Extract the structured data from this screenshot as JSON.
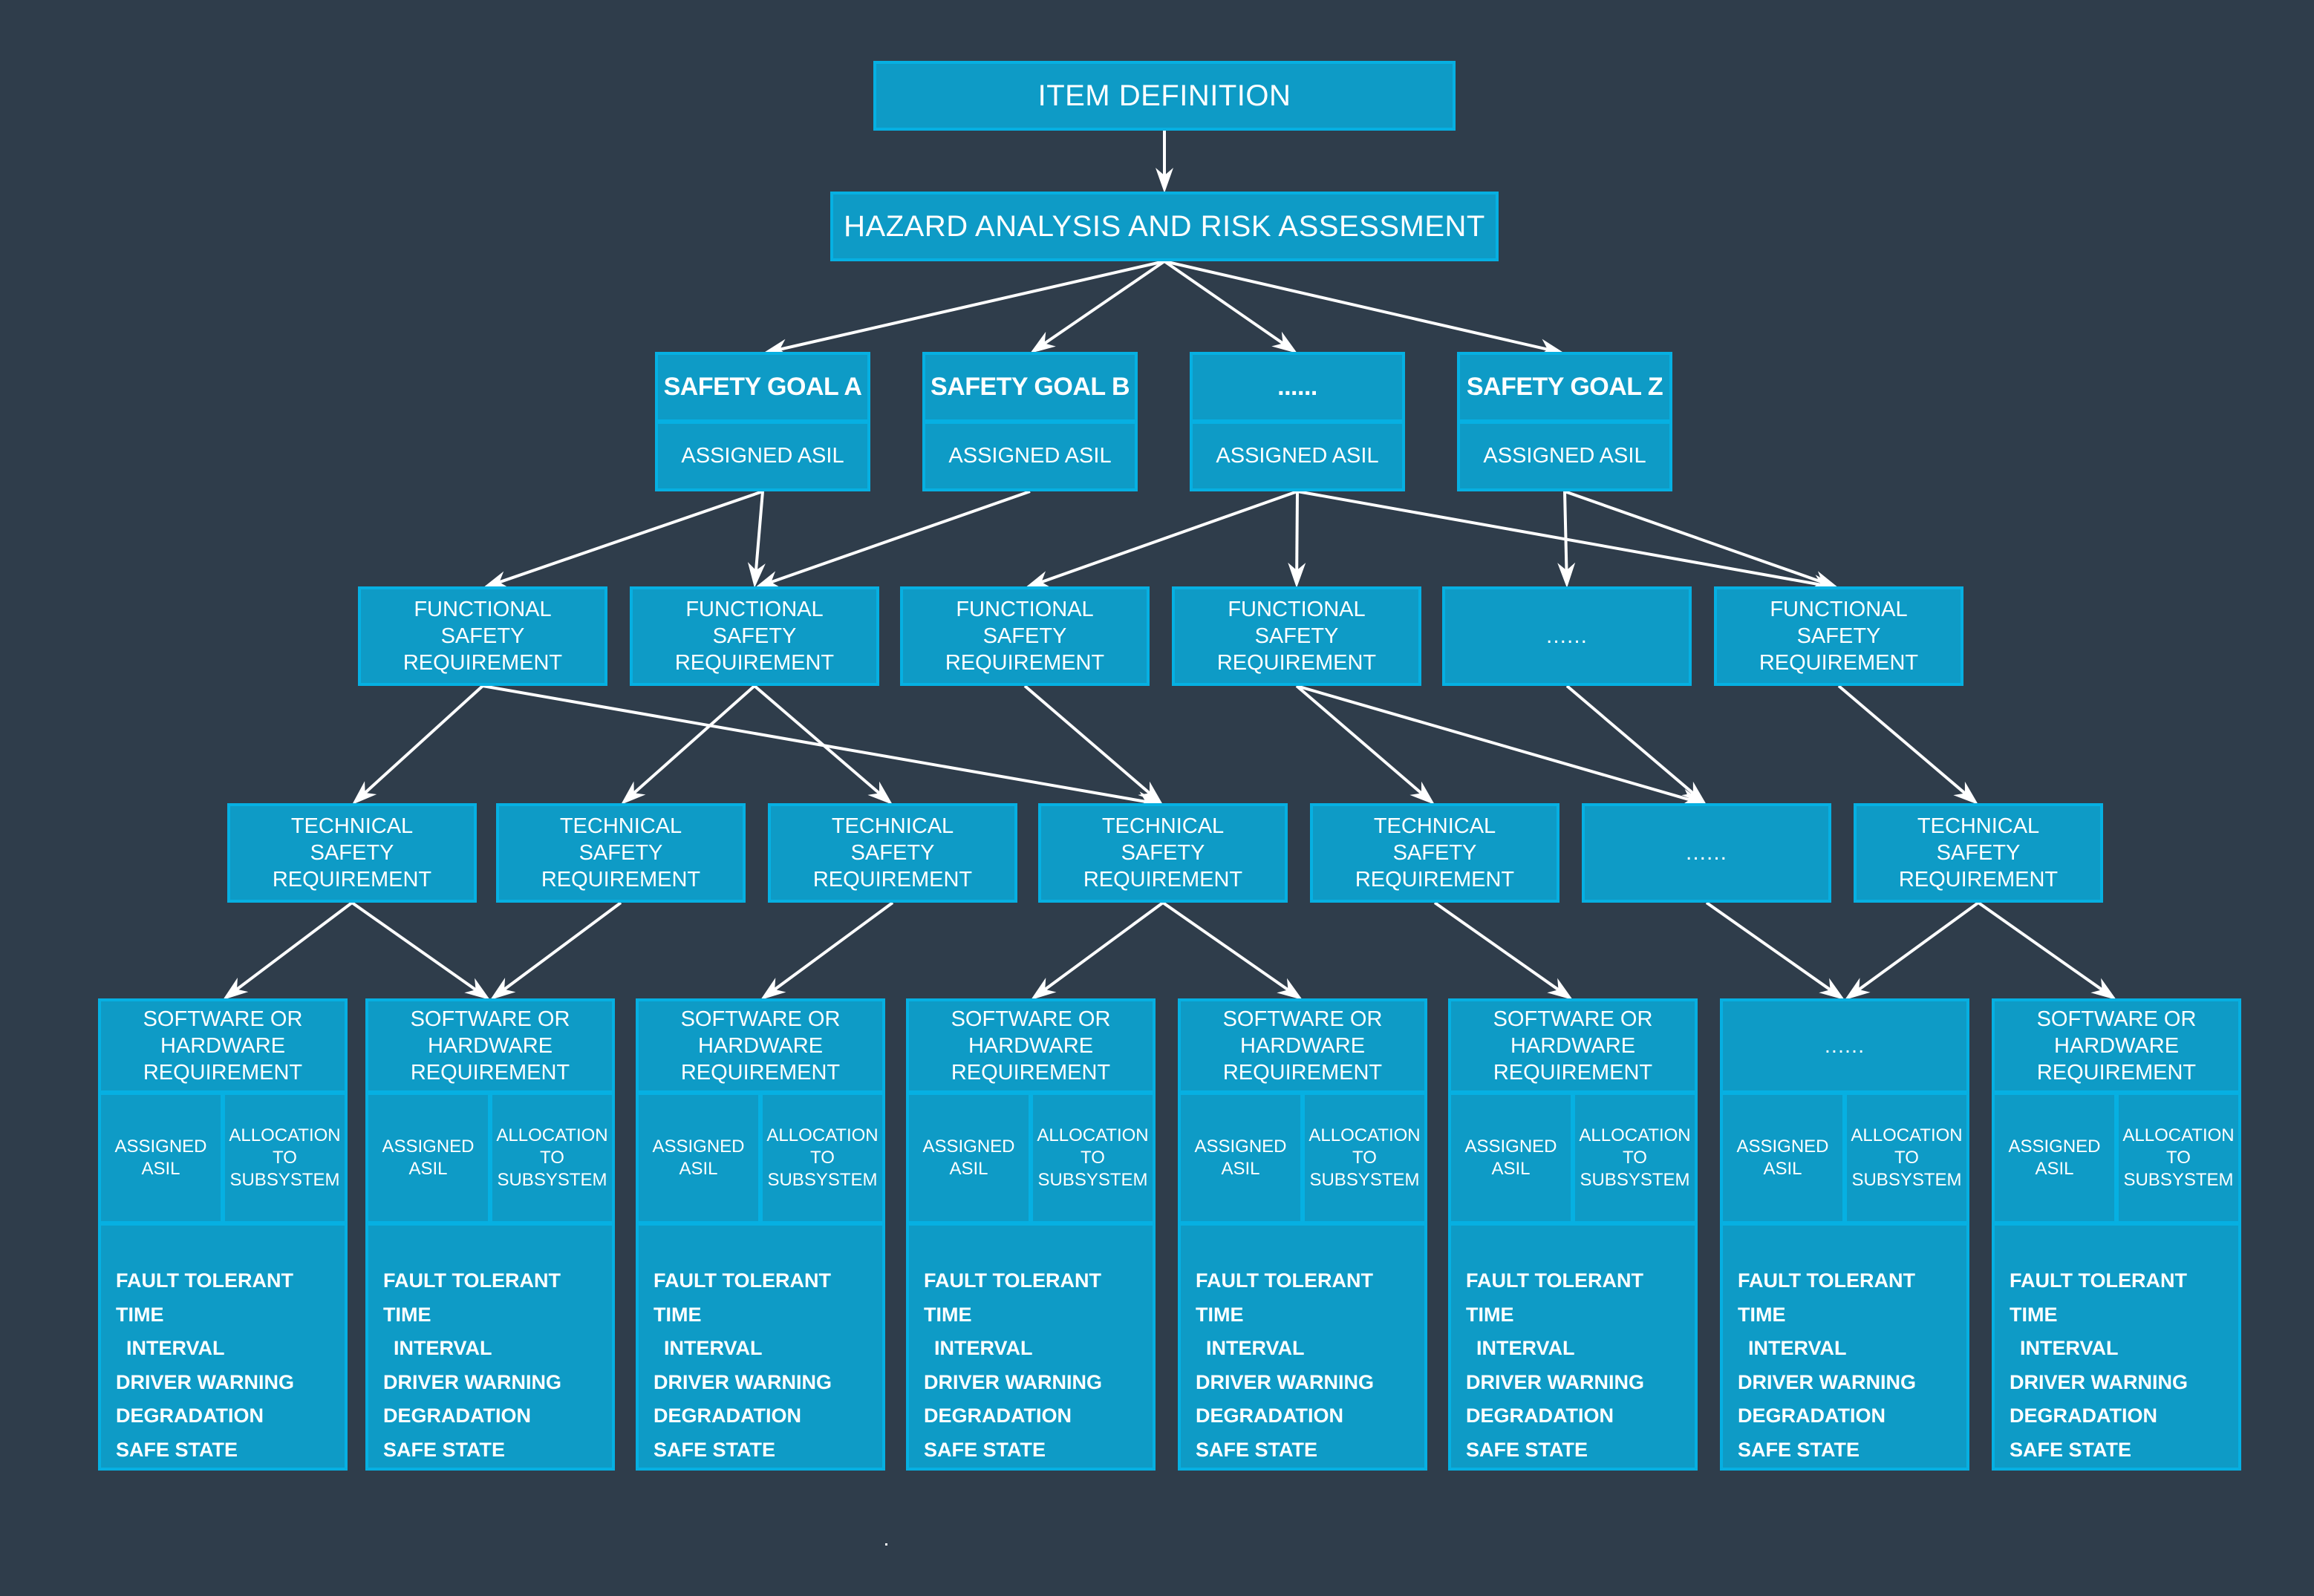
{
  "colors": {
    "background": "#2f3d4b",
    "box_fill": "#0e9bc6",
    "box_border": "#06b0e2",
    "arrow": "#ffffff",
    "text": "#ffffff"
  },
  "item_definition": "ITEM DEFINITION",
  "hara": "HAZARD ANALYSIS AND RISK ASSESSMENT",
  "safety_goals": [
    {
      "id": "sg1",
      "title": "SAFETY GOAL A",
      "asil": "ASSIGNED ASIL"
    },
    {
      "id": "sg2",
      "title": "SAFETY GOAL B",
      "asil": "ASSIGNED ASIL"
    },
    {
      "id": "sg3",
      "title": "......",
      "asil": "ASSIGNED ASIL"
    },
    {
      "id": "sg4",
      "title": "SAFETY GOAL Z",
      "asil": "ASSIGNED ASIL"
    }
  ],
  "functional_safety_requirements": [
    {
      "id": "fsr1",
      "lines": [
        "FUNCTIONAL",
        "SAFETY",
        "REQUIREMENT"
      ]
    },
    {
      "id": "fsr2",
      "lines": [
        "FUNCTIONAL",
        "SAFETY",
        "REQUIREMENT"
      ]
    },
    {
      "id": "fsr3",
      "lines": [
        "FUNCTIONAL",
        "SAFETY",
        "REQUIREMENT"
      ]
    },
    {
      "id": "fsr4",
      "lines": [
        "FUNCTIONAL",
        "SAFETY",
        "REQUIREMENT"
      ]
    },
    {
      "id": "fsr5",
      "lines": [
        "......",
        "",
        ""
      ]
    },
    {
      "id": "fsr6",
      "lines": [
        "FUNCTIONAL",
        "SAFETY",
        "REQUIREMENT"
      ]
    }
  ],
  "technical_safety_requirements": [
    {
      "id": "tsr1",
      "lines": [
        "TECHNICAL",
        "SAFETY",
        "REQUIREMENT"
      ]
    },
    {
      "id": "tsr2",
      "lines": [
        "TECHNICAL",
        "SAFETY",
        "REQUIREMENT"
      ]
    },
    {
      "id": "tsr3",
      "lines": [
        "TECHNICAL",
        "SAFETY",
        "REQUIREMENT"
      ]
    },
    {
      "id": "tsr4",
      "lines": [
        "TECHNICAL",
        "SAFETY",
        "REQUIREMENT"
      ]
    },
    {
      "id": "tsr5",
      "lines": [
        "TECHNICAL",
        "SAFETY",
        "REQUIREMENT"
      ]
    },
    {
      "id": "tsr6",
      "lines": [
        "......",
        "",
        ""
      ]
    },
    {
      "id": "tsr7",
      "lines": [
        "TECHNICAL",
        "SAFETY",
        "REQUIREMENT"
      ]
    }
  ],
  "sw_hw_requirements": [
    {
      "id": "sw1",
      "head": [
        "SOFTWARE OR",
        "HARDWARE",
        "REQUIREMENT"
      ],
      "asil": [
        "ASSIGNED",
        "ASIL"
      ],
      "allocation": [
        "ALLOCATION",
        "TO",
        "SUBSYSTEM"
      ],
      "attributes": [
        "FAULT TOLERANT TIME",
        "INTERVAL",
        "DRIVER WARNING",
        "DEGRADATION",
        "SAFE STATE"
      ]
    },
    {
      "id": "sw2",
      "head": [
        "SOFTWARE OR",
        "HARDWARE",
        "REQUIREMENT"
      ],
      "asil": [
        "ASSIGNED",
        "ASIL"
      ],
      "allocation": [
        "ALLOCATION",
        "TO",
        "SUBSYSTEM"
      ],
      "attributes": [
        "FAULT TOLERANT TIME",
        "INTERVAL",
        "DRIVER WARNING",
        "DEGRADATION",
        "SAFE STATE"
      ]
    },
    {
      "id": "sw3",
      "head": [
        "SOFTWARE OR",
        "HARDWARE",
        "REQUIREMENT"
      ],
      "asil": [
        "ASSIGNED",
        "ASIL"
      ],
      "allocation": [
        "ALLOCATION",
        "TO",
        "SUBSYSTEM"
      ],
      "attributes": [
        "FAULT TOLERANT TIME",
        "INTERVAL",
        "DRIVER WARNING",
        "DEGRADATION",
        "SAFE STATE"
      ]
    },
    {
      "id": "sw4",
      "head": [
        "SOFTWARE OR",
        "HARDWARE",
        "REQUIREMENT"
      ],
      "asil": [
        "ASSIGNED",
        "ASIL"
      ],
      "allocation": [
        "ALLOCATION",
        "TO",
        "SUBSYSTEM"
      ],
      "attributes": [
        "FAULT TOLERANT TIME",
        "INTERVAL",
        "DRIVER WARNING",
        "DEGRADATION",
        "SAFE STATE"
      ]
    },
    {
      "id": "sw5",
      "head": [
        "SOFTWARE OR",
        "HARDWARE",
        "REQUIREMENT"
      ],
      "asil": [
        "ASSIGNED",
        "ASIL"
      ],
      "allocation": [
        "ALLOCATION",
        "TO",
        "SUBSYSTEM"
      ],
      "attributes": [
        "FAULT TOLERANT TIME",
        "INTERVAL",
        "DRIVER WARNING",
        "DEGRADATION",
        "SAFE STATE"
      ]
    },
    {
      "id": "sw6",
      "head": [
        "SOFTWARE OR",
        "HARDWARE",
        "REQUIREMENT"
      ],
      "asil": [
        "ASSIGNED",
        "ASIL"
      ],
      "allocation": [
        "ALLOCATION",
        "TO",
        "SUBSYSTEM"
      ],
      "attributes": [
        "FAULT TOLERANT TIME",
        "INTERVAL",
        "DRIVER WARNING",
        "DEGRADATION",
        "SAFE STATE"
      ]
    },
    {
      "id": "sw7",
      "head": [
        "......",
        "",
        ""
      ],
      "asil": [
        "ASSIGNED",
        "ASIL"
      ],
      "allocation": [
        "ALLOCATION",
        "TO",
        "SUBSYSTEM"
      ],
      "attributes": [
        "FAULT TOLERANT TIME",
        "INTERVAL",
        "DRIVER WARNING",
        "DEGRADATION",
        "SAFE STATE"
      ]
    },
    {
      "id": "sw8",
      "head": [
        "SOFTWARE OR",
        "HARDWARE",
        "REQUIREMENT"
      ],
      "asil": [
        "ASSIGNED",
        "ASIL"
      ],
      "allocation": [
        "ALLOCATION",
        "TO",
        "SUBSYSTEM"
      ],
      "attributes": [
        "FAULT TOLERANT TIME",
        "INTERVAL",
        "DRIVER WARNING",
        "DEGRADATION",
        "SAFE STATE"
      ]
    }
  ],
  "edges": [
    [
      "item",
      "hara"
    ],
    [
      "hara",
      "sg1"
    ],
    [
      "hara",
      "sg2"
    ],
    [
      "hara",
      "sg3"
    ],
    [
      "hara",
      "sg4"
    ],
    [
      "sg1",
      "fsr1"
    ],
    [
      "sg1",
      "fsr2"
    ],
    [
      "sg2",
      "fsr2"
    ],
    [
      "sg3",
      "fsr3"
    ],
    [
      "sg3",
      "fsr4"
    ],
    [
      "sg3",
      "fsr6"
    ],
    [
      "sg4",
      "fsr5"
    ],
    [
      "sg4",
      "fsr6"
    ],
    [
      "fsr1",
      "tsr1"
    ],
    [
      "fsr1",
      "tsr4"
    ],
    [
      "fsr2",
      "tsr2"
    ],
    [
      "fsr2",
      "tsr3"
    ],
    [
      "fsr3",
      "tsr4"
    ],
    [
      "fsr4",
      "tsr5"
    ],
    [
      "fsr4",
      "tsr6"
    ],
    [
      "fsr5",
      "tsr6"
    ],
    [
      "fsr6",
      "tsr7"
    ],
    [
      "tsr1",
      "sw1"
    ],
    [
      "tsr1",
      "sw2"
    ],
    [
      "tsr2",
      "sw2"
    ],
    [
      "tsr3",
      "sw3"
    ],
    [
      "tsr4",
      "sw4"
    ],
    [
      "tsr4",
      "sw5"
    ],
    [
      "tsr5",
      "sw6"
    ],
    [
      "tsr6",
      "sw7"
    ],
    [
      "tsr7",
      "sw7"
    ],
    [
      "tsr7",
      "sw8"
    ]
  ]
}
